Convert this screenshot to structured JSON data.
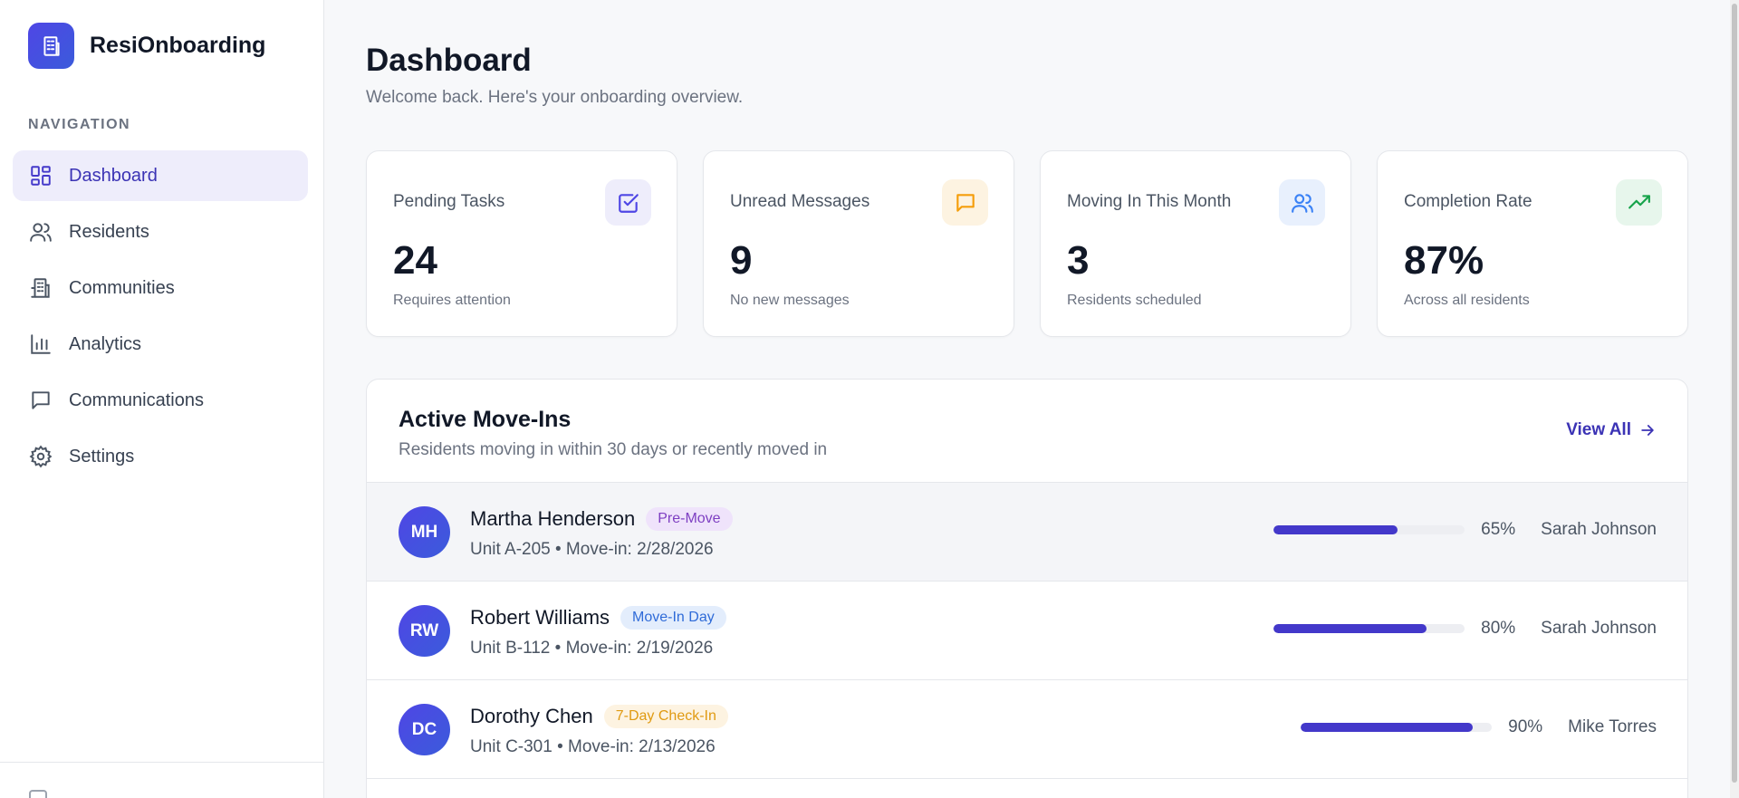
{
  "app": {
    "name": "ResiOnboarding"
  },
  "sidebar": {
    "heading": "NAVIGATION",
    "items": [
      {
        "label": "Dashboard",
        "icon": "dashboard-icon",
        "active": true
      },
      {
        "label": "Residents",
        "icon": "users-icon"
      },
      {
        "label": "Communities",
        "icon": "building-icon"
      },
      {
        "label": "Analytics",
        "icon": "bar-chart-icon"
      },
      {
        "label": "Communications",
        "icon": "message-icon"
      },
      {
        "label": "Settings",
        "icon": "gear-icon"
      }
    ]
  },
  "page": {
    "title": "Dashboard",
    "subtitle": "Welcome back. Here's your onboarding overview."
  },
  "stats": [
    {
      "label": "Pending Tasks",
      "value": "24",
      "note": "Requires attention",
      "icon": "check-square-icon",
      "color": "#4f46e5",
      "bg": "#eeedfb"
    },
    {
      "label": "Unread Messages",
      "value": "9",
      "note": "No new messages",
      "icon": "message-icon",
      "color": "#f59e0b",
      "bg": "#fdf3e1"
    },
    {
      "label": "Moving In This Month",
      "value": "3",
      "note": "Residents scheduled",
      "icon": "users-icon",
      "color": "#3b82f6",
      "bg": "#e8f0fd"
    },
    {
      "label": "Completion Rate",
      "value": "87%",
      "note": "Across all residents",
      "icon": "trending-up-icon",
      "color": "#16a34a",
      "bg": "#e7f6ec"
    }
  ],
  "moveins": {
    "title": "Active Move-Ins",
    "subtitle": "Residents moving in within 30 days or recently moved in",
    "view_all": "View All",
    "rows": [
      {
        "initials": "MH",
        "name": "Martha Henderson",
        "badge": "Pre-Move",
        "badge_color": "#7e3fc2",
        "badge_bg": "#efe3fb",
        "meta": "Unit A-205 • Move-in: 2/28/2026",
        "progress": 65,
        "progress_label": "65%",
        "assignee": "Sarah Johnson"
      },
      {
        "initials": "RW",
        "name": "Robert Williams",
        "badge": "Move-In Day",
        "badge_color": "#2f6bd8",
        "badge_bg": "#e3edfc",
        "meta": "Unit B-112 • Move-in: 2/19/2026",
        "progress": 80,
        "progress_label": "80%",
        "assignee": "Sarah Johnson"
      },
      {
        "initials": "DC",
        "name": "Dorothy Chen",
        "badge": "7-Day Check-In",
        "badge_color": "#e09a12",
        "badge_bg": "#fdf3e1",
        "meta": "Unit C-301 • Move-in: 2/13/2026",
        "progress": 90,
        "progress_label": "90%",
        "assignee": "Mike Torres"
      }
    ]
  }
}
